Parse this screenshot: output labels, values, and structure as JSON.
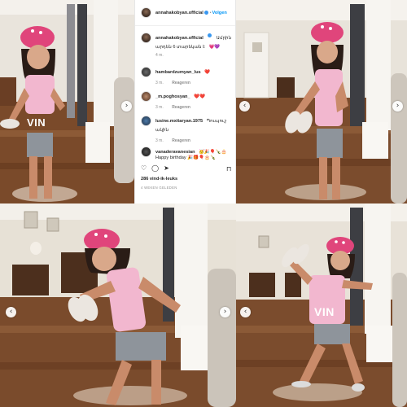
{
  "post": {
    "author": "annahakobyan.official",
    "follow_label": "Volgen",
    "caption_text": "Ամրին արդեն 6 տարեկան է",
    "caption_emoji": "💗💜",
    "caption_time": "4 m.",
    "likes": "286 vind-ik-leuks",
    "posted": "4 WEKEN GELEDEN"
  },
  "comments": [
    {
      "user": "hambardzumyan_lus",
      "text": "❤️",
      "time": "3 m.",
      "reply": "Reageren"
    },
    {
      "user": "_m.poghosyan_",
      "text": "❤️❤️",
      "time": "3 m.",
      "reply": "Reageren"
    },
    {
      "user": "lusine.mxitaryan.1975",
      "text": "Պուպուշ ակին",
      "time": "3 m.",
      "reply": "Reageren"
    },
    {
      "user": "vanaderavanesian",
      "text": "🥳🎉🎈🍾🎂",
      "text2": "Happy birthday 🎉🎁🎈🎂🍾",
      "time": "",
      "reply": ""
    }
  ],
  "icons": {
    "like": "heart-icon",
    "comment": "comment-icon",
    "share": "share-icon",
    "save": "bookmark-icon",
    "prev": "chevron-left-icon",
    "next": "chevron-right-icon"
  },
  "photo": {
    "shirt_print": "VIN"
  },
  "colors": {
    "link_blue": "#0095f6",
    "heart_red": "#ed4956",
    "helmet_pink": "#e0457b"
  }
}
